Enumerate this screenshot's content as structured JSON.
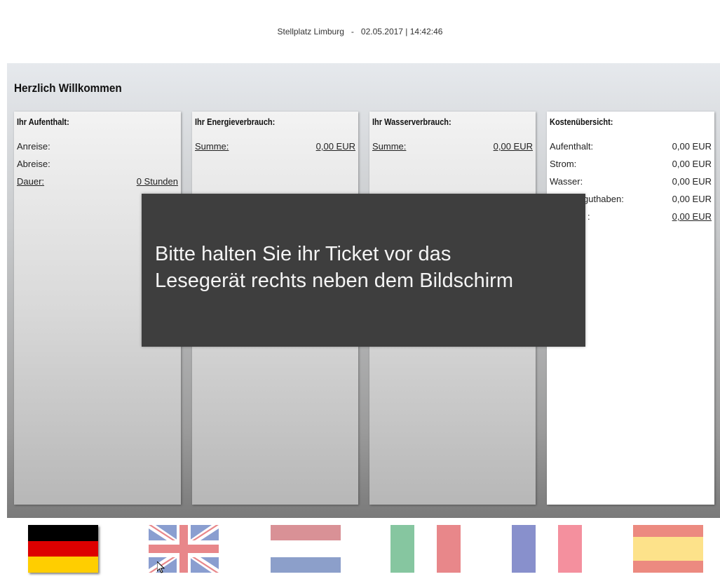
{
  "header": {
    "location": "Stellplatz Limburg",
    "separator": "-",
    "datetime": "02.05.2017 | 14:42:46"
  },
  "welcome": "Herzlich Willkommen",
  "panels": {
    "stay": {
      "title": "Ihr Aufenthalt:",
      "arrival_label": "Anreise:",
      "departure_label": "Abreise:",
      "duration_label": "Dauer:",
      "duration_value": "0 Stunden"
    },
    "energy": {
      "title": "Ihr Energieverbrauch:",
      "sum_label": "Summe:",
      "sum_value": "0,00 EUR"
    },
    "water": {
      "title": "Ihr Wasserverbrauch:",
      "sum_label": "Summe:",
      "sum_value": "0,00 EUR"
    },
    "costs": {
      "title": "Kostenübersicht:",
      "rows": [
        {
          "label": "Aufenthalt:",
          "value": "0,00 EUR"
        },
        {
          "label": "Strom:",
          "value": "0,00 EUR"
        },
        {
          "label": "Wasser:",
          "value": "0,00 EUR"
        },
        {
          "label": "guthaben:",
          "value": "0,00 EUR"
        },
        {
          "label": ":",
          "value": "0,00 EUR"
        }
      ]
    }
  },
  "overlay": {
    "line1": "Bitte halten Sie ihr Ticket vor das",
    "line2": "Lesegerät rechts neben dem Bildschirm"
  },
  "flags": [
    {
      "name": "german-flag"
    },
    {
      "name": "uk-flag"
    },
    {
      "name": "dutch-flag"
    },
    {
      "name": "italian-flag"
    },
    {
      "name": "french-flag"
    },
    {
      "name": "spanish-flag"
    }
  ],
  "colors": {
    "overlay_bg": "#3e3e3e",
    "de_black": "#000000",
    "de_red": "#dd0000",
    "de_gold": "#ffce00",
    "faded_red": "#e8878a",
    "faded_blue": "#8a9ed0",
    "faded_green": "#86c6a0",
    "faded_fr_blue": "#8890cc",
    "faded_es_yellow": "#fde28a"
  }
}
